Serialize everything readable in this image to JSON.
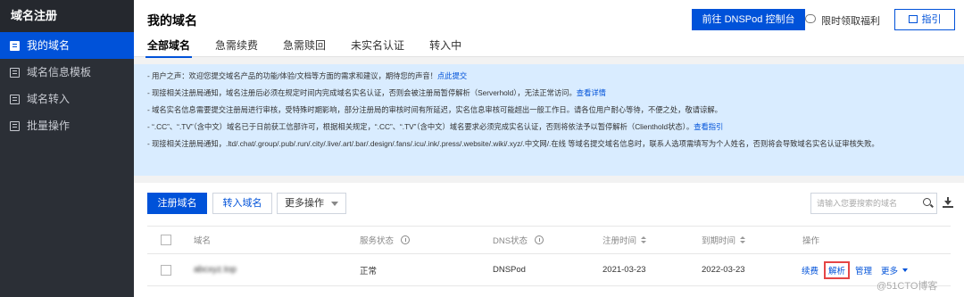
{
  "sidebar": {
    "title": "域名注册",
    "items": [
      {
        "label": "我的域名",
        "active": true
      },
      {
        "label": "域名信息模板",
        "active": false
      },
      {
        "label": "域名转入",
        "active": false
      },
      {
        "label": "批量操作",
        "active": false
      }
    ]
  },
  "header": {
    "title": "我的域名",
    "tabs": [
      "全部域名",
      "急需续费",
      "急需赎回",
      "未实名认证",
      "转入中"
    ],
    "active_tab": 0,
    "dnspod_button": "前往 DNSPod 控制台",
    "welfare_link": "限时领取福利",
    "guide_button": "指引"
  },
  "notice": {
    "line1": {
      "text": "- 用户之声：欢迎您提交域名产品的功能/体验/文档等方面的需求和建议，期待您的声音！",
      "link": "点此提交"
    },
    "line2": {
      "text": "- 现接相关注册局通知，域名注册后必须在规定时间内完成域名实名认证，否则会被注册局暂停解析（Serverhold），无法正常访问。",
      "link": "查看详情"
    },
    "line3": {
      "text": "- 域名实名信息需要提交注册局进行审核，受特殊时期影响，部分注册局的审核时间有所延迟，实名信息审核可能超出一般工作日。请各位用户耐心等待，不便之处，敬请谅解。"
    },
    "line4": {
      "text": "- “.CC”、“.TV”（含中文）域名已于日前获工信部许可，根据相关规定，“.CC”、“.TV”（含中文）域名要求必须完成实名认证，否则将依法予以暂停解析（Clienthold状态）。",
      "link": "查看指引"
    },
    "line5": {
      "text": "- 现接相关注册局通知，.ltd/.chat/.group/.pub/.run/.city/.live/.art/.bar/.design/.fans/.icu/.ink/.press/.website/.wiki/.xyz/.中文网/.在线 等域名提交域名信息时，联系人选项需填写为个人姓名，否则将会导致域名实名认证审核失败。"
    }
  },
  "toolbar": {
    "register_button": "注册域名",
    "transfer_button": "转入域名",
    "more_select": "更多操作",
    "search_placeholder": "请输入您要搜索的域名"
  },
  "table": {
    "columns": [
      "域名",
      "服务状态",
      "DNS状态",
      "注册时间",
      "到期时间",
      "操作"
    ],
    "rows": [
      {
        "domain": "abcxyz.top",
        "service_status": "正常",
        "dns_status": "DNSPod",
        "registered": "2021-03-23",
        "expires": "2022-03-23",
        "actions": {
          "renew": "续费",
          "resolve": "解析",
          "manage": "管理",
          "more": "更多"
        }
      }
    ]
  },
  "watermark": "@51CTO博客",
  "colors": {
    "primary": "#0052d9",
    "sidebar_bg": "#2b2f36",
    "notice_bg": "#d9ecff",
    "success": "#0abf5b",
    "highlight": "#e54545"
  }
}
